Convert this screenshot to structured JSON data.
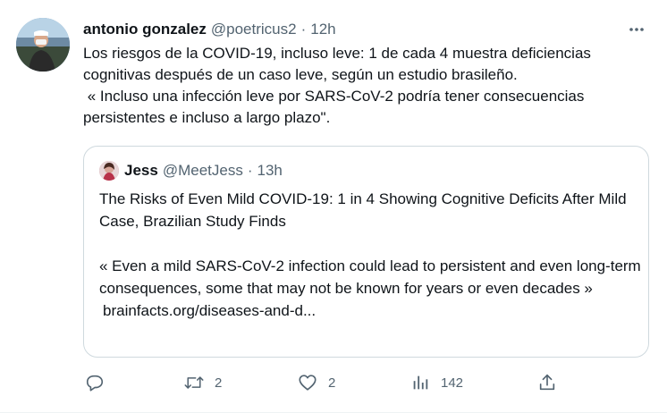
{
  "tweet": {
    "display_name": "antonio gonzalez",
    "handle": "@poetricus2",
    "separator": "·",
    "time": "12h",
    "more_icon": "more-horizontal-icon",
    "text_line1": "Los riesgos de la COVID-19, incluso leve: 1 de cada 4 muestra deficiencias cognitivas después de un caso leve, según un estudio brasileño.",
    "text_line2": " « Incluso una infección leve por SARS-CoV-2 podría tener consecuencias persistentes e incluso a largo plazo\"."
  },
  "quote": {
    "display_name": "Jess",
    "handle": "@MeetJess",
    "separator": "·",
    "time": "13h",
    "title": "The Risks of Even Mild COVID-19: 1 in 4 Showing Cognitive Deficits After Mild Case, Brazilian Study Finds",
    "excerpt": "« Even a mild SARS-CoV-2 infection could lead to persistent and even long-term consequences, some that may not be known for years or even decades »",
    "link": "brainfacts.org/diseases-and-d..."
  },
  "actions": {
    "reply": {
      "icon": "reply-icon",
      "count": ""
    },
    "retweet": {
      "icon": "retweet-icon",
      "count": "2"
    },
    "like": {
      "icon": "heart-icon",
      "count": "2"
    },
    "views": {
      "icon": "views-icon",
      "count": "142"
    },
    "share": {
      "icon": "share-icon",
      "count": ""
    }
  },
  "colors": {
    "primary_text": "#0f1419",
    "secondary_text": "#536471",
    "border": "#cfd9de"
  }
}
